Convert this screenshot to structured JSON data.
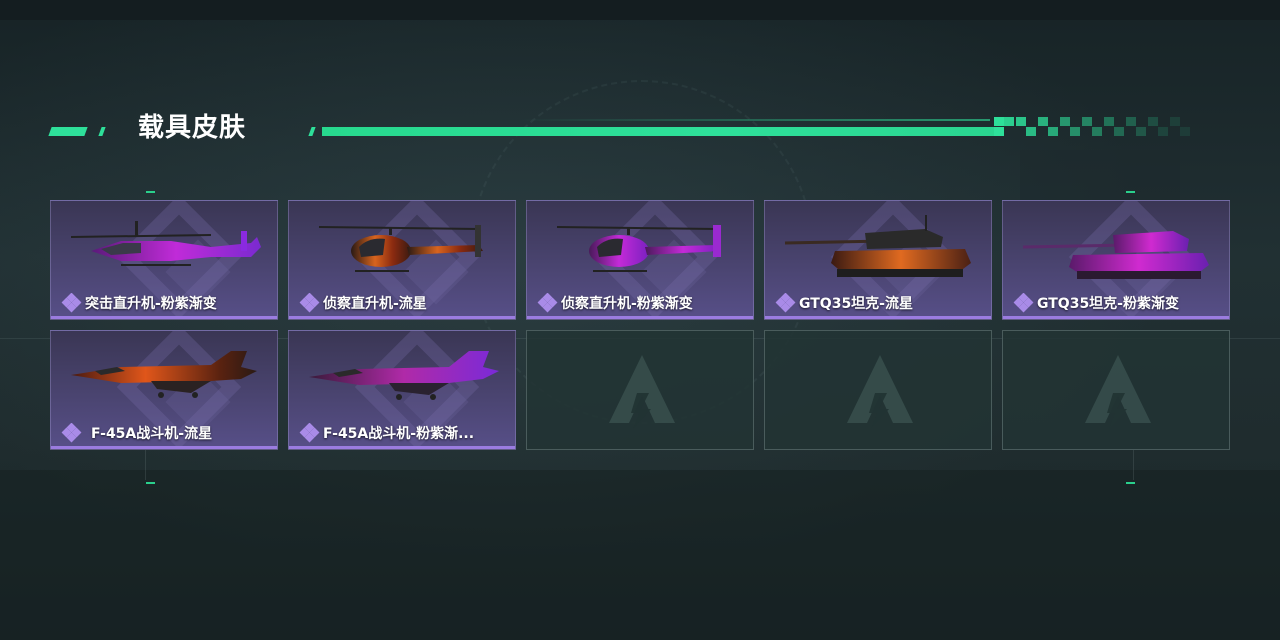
{
  "header": {
    "title": "载具皮肤"
  },
  "colors": {
    "accent": "#2ee09a",
    "card_purple": "#4a4470",
    "rarity_purple": "#9b7ce0",
    "empty_card": "#223434"
  },
  "skins": [
    {
      "name": "突击直升机-粉紫渐变",
      "icon": "attack-helicopter-icon",
      "theme": "purple"
    },
    {
      "name": "侦察直升机-流星",
      "icon": "scout-helicopter-icon",
      "theme": "meteor"
    },
    {
      "name": "侦察直升机-粉紫渐变",
      "icon": "scout-helicopter-icon",
      "theme": "purple"
    },
    {
      "name": "GTQ35坦克-流星",
      "icon": "tank-icon",
      "theme": "meteor"
    },
    {
      "name": "GTQ35坦克-粉紫渐变",
      "icon": "tank-icon",
      "theme": "purple"
    },
    {
      "name": "F-45A战斗机-流星",
      "icon": "fighter-jet-icon",
      "theme": "meteor"
    },
    {
      "name": "F-45A战斗机-粉紫渐...",
      "icon": "fighter-jet-icon",
      "theme": "purple"
    }
  ],
  "empty_slots": [
    {
      "icon": "empty-slot-logo-icon"
    },
    {
      "icon": "empty-slot-logo-icon"
    },
    {
      "icon": "empty-slot-logo-icon"
    }
  ]
}
